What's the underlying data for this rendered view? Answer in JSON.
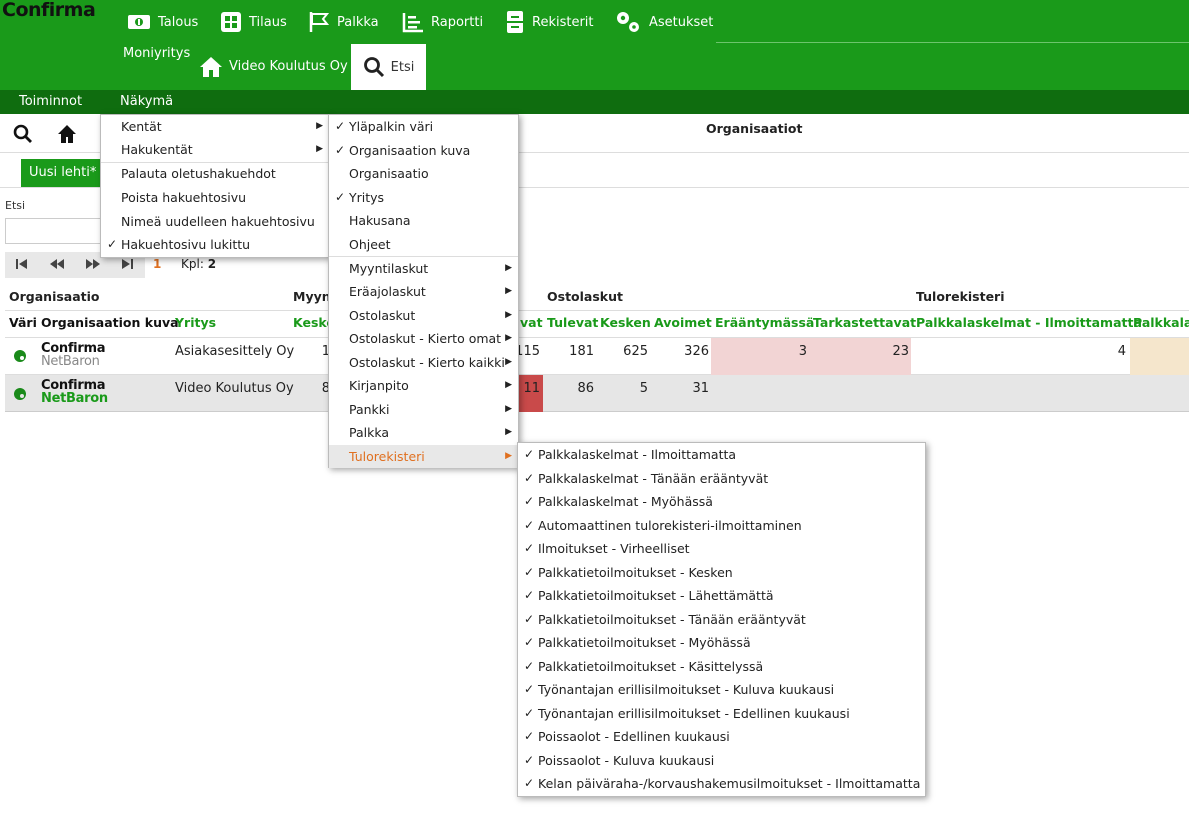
{
  "app": {
    "logo": "Confirma",
    "nav": [
      {
        "label": "Talous",
        "icon": "money-icon"
      },
      {
        "label": "Tilaus",
        "icon": "grid-icon"
      },
      {
        "label": "Palkka",
        "icon": "flag-icon"
      },
      {
        "label": "Raportti",
        "icon": "report-icon"
      },
      {
        "label": "Rekisterit",
        "icon": "cabinet-icon"
      },
      {
        "label": "Asetukset",
        "icon": "gears-icon"
      }
    ],
    "moniyritys": "Moniyritys",
    "company": "Video Koulutus Oy",
    "search_tab": "Etsi"
  },
  "menubar": {
    "toiminnot": "Toiminnot",
    "nakyma": "Näkymä"
  },
  "toolbar": {
    "title": "Organisaatiot"
  },
  "tabs": {
    "active": "Uusi lehti*"
  },
  "search": {
    "label": "Etsi",
    "value": ""
  },
  "pager": {
    "page": "1",
    "count_label": "Kpl:",
    "count": "2"
  },
  "groups": {
    "organisaatio": "Organisaatio",
    "myyntilaskut": "Myyn",
    "ostolaskut": "Ostolaskut",
    "tulorekisteri": "Tulorekisteri"
  },
  "columns": {
    "vari": "Väri",
    "kuva": "Organisaation kuva",
    "yritys": "Yritys",
    "myynti_kesken": "Keske",
    "ost_prev": "vat",
    "tulevat": "Tulevat",
    "kesken": "Kesken",
    "avoimet": "Avoimet",
    "erantymassa": "Erääntymässä",
    "tarkastettavat": "Tarkastettavat",
    "palkka_ilm": "Palkkalaskelmat - Ilmoittamatta",
    "palkka_cut": "Palkkala"
  },
  "rows": [
    {
      "logo_top": "Confirma",
      "logo_bottom": "NetBaron",
      "yritys": "Asiakasesittely Oy",
      "myynti": "1",
      "ost_prev": "115",
      "tulevat": "181",
      "kesken": "625",
      "avoimet": "326",
      "erantymassa": "3",
      "tarkastettavat": "23",
      "palkka": "4"
    },
    {
      "logo_top": "Confirma",
      "logo_bottom": "NetBaron",
      "yritys": "Video Koulutus Oy",
      "myynti": "8",
      "ost_prev": "11",
      "tulevat": "86",
      "kesken": "5",
      "avoimet": "31",
      "erantymassa": "",
      "tarkastettavat": "",
      "palkka": ""
    }
  ],
  "menu1": [
    {
      "label": "Kentät",
      "check": false,
      "arrow": true
    },
    {
      "label": "Hakukentät",
      "check": false,
      "arrow": true
    },
    {
      "label": "Palauta oletushakuehdot",
      "check": false,
      "arrow": false
    },
    {
      "label": "Poista hakuehtosivu",
      "check": false,
      "arrow": false
    },
    {
      "label": "Nimeä uudelleen hakuehtosivu",
      "check": false,
      "arrow": false
    },
    {
      "label": "Hakuehtosivu lukittu",
      "check": true,
      "arrow": false
    }
  ],
  "menu2": [
    {
      "label": "Yläpalkin väri",
      "check": true,
      "arrow": false
    },
    {
      "label": "Organisaation kuva",
      "check": true,
      "arrow": false
    },
    {
      "label": "Organisaatio",
      "check": false,
      "arrow": false
    },
    {
      "label": "Yritys",
      "check": true,
      "arrow": false
    },
    {
      "label": "Hakusana",
      "check": false,
      "arrow": false
    },
    {
      "label": "Ohjeet",
      "check": false,
      "arrow": false
    },
    {
      "label": "Myyntilaskut",
      "check": false,
      "arrow": true
    },
    {
      "label": "Eräajolaskut",
      "check": false,
      "arrow": true
    },
    {
      "label": "Ostolaskut",
      "check": false,
      "arrow": true
    },
    {
      "label": "Ostolaskut - Kierto omat",
      "check": false,
      "arrow": true
    },
    {
      "label": "Ostolaskut - Kierto kaikki",
      "check": false,
      "arrow": true
    },
    {
      "label": "Kirjanpito",
      "check": false,
      "arrow": true
    },
    {
      "label": "Pankki",
      "check": false,
      "arrow": true
    },
    {
      "label": "Palkka",
      "check": false,
      "arrow": true
    },
    {
      "label": "Tulorekisteri",
      "check": false,
      "arrow": true,
      "active": true
    }
  ],
  "menu3": [
    "Palkkalaskelmat - Ilmoittamatta",
    "Palkkalaskelmat - Tänään erääntyvät",
    "Palkkalaskelmat - Myöhässä",
    "Automaattinen tulorekisteri-ilmoittaminen",
    "Ilmoitukset - Virheelliset",
    "Palkkatietoilmoitukset - Kesken",
    "Palkkatietoilmoitukset - Lähettämättä",
    "Palkkatietoilmoitukset - Tänään erääntyvät",
    "Palkkatietoilmoitukset - Myöhässä",
    "Palkkatietoilmoitukset - Käsittelyssä",
    "Työnantajan erillisilmoitukset - Kuluva kuukausi",
    "Työnantajan erillisilmoitukset - Edellinen kuukausi",
    "Poissaolot - Edellinen kuukausi",
    "Poissaolot - Kuluva kuukausi",
    "Kelan päiväraha-/korvaushakemusilmoitukset - Ilmoittamatta"
  ],
  "menu3_check": "✓",
  "colors": {
    "brand": "#1a9a1a",
    "menubar": "#0f6d0f",
    "active_menu": "#e07020",
    "pink": "#f2d4d4",
    "red": "#c94a4a",
    "beige": "#f5e6cc"
  }
}
